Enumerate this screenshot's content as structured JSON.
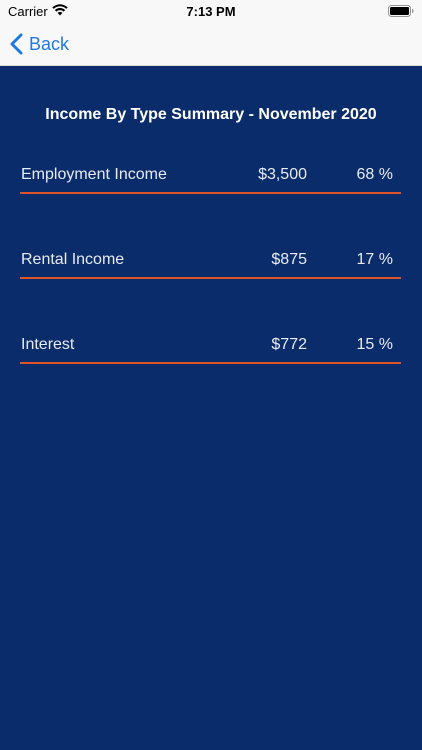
{
  "status_bar": {
    "carrier": "Carrier",
    "time": "7:13 PM"
  },
  "nav": {
    "back_label": "Back"
  },
  "summary": {
    "title": "Income By Type Summary - November 2020",
    "rows": [
      {
        "name": "Employment Income",
        "amount": "$3,500",
        "percent": "68 %"
      },
      {
        "name": "Rental Income",
        "amount": "$875",
        "percent": "17 %"
      },
      {
        "name": "Interest",
        "amount": "$772",
        "percent": "15 %"
      }
    ]
  },
  "colors": {
    "background": "#0b2c6b",
    "divider": "#e0542a",
    "link": "#1f7ae0"
  }
}
